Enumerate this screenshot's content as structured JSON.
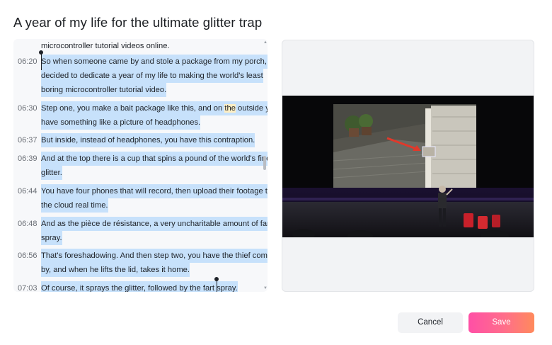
{
  "dialog": {
    "title": "A year of my life for the ultimate glitter trap",
    "cancel_label": "Cancel",
    "save_label": "Save"
  },
  "transcript": {
    "lead_line": "microcontroller tutorial videos online.",
    "entries": [
      {
        "time": "06:20",
        "lines": [
          "So when someone came by and stole a package from my porch, I",
          "decided to dedicate a year of my life to making the world's least",
          "boring microcontroller tutorial video."
        ]
      },
      {
        "time": "06:30",
        "line1_before": "Step one, you make a bait package like this, and on ",
        "line1_highlight": "the",
        "line1_after": " outside you",
        "line2": "have something like a picture of headphones."
      },
      {
        "time": "06:37",
        "lines": [
          "But inside, instead of headphones, you have this contraption."
        ]
      },
      {
        "time": "06:39",
        "lines": [
          "And at the top there is a cup that spins a pound of the world's finest",
          "glitter."
        ]
      },
      {
        "time": "06:44",
        "lines": [
          "You have four phones that will record, then upload their footage to",
          "the cloud real time."
        ]
      },
      {
        "time": "06:48",
        "lines": [
          "And as the pièce de résistance, a very uncharitable amount of fart",
          "spray."
        ]
      },
      {
        "time": "06:56",
        "lines": [
          "That's foreshadowing. And then step two, you have the thief come",
          "by, and when he lifts the lid, takes it home."
        ]
      },
      {
        "time": "07:03",
        "lines": [
          "Of course, it sprays the glitter, followed by the fart spray."
        ]
      }
    ]
  },
  "video": {
    "accent_color": "#e0392b"
  }
}
